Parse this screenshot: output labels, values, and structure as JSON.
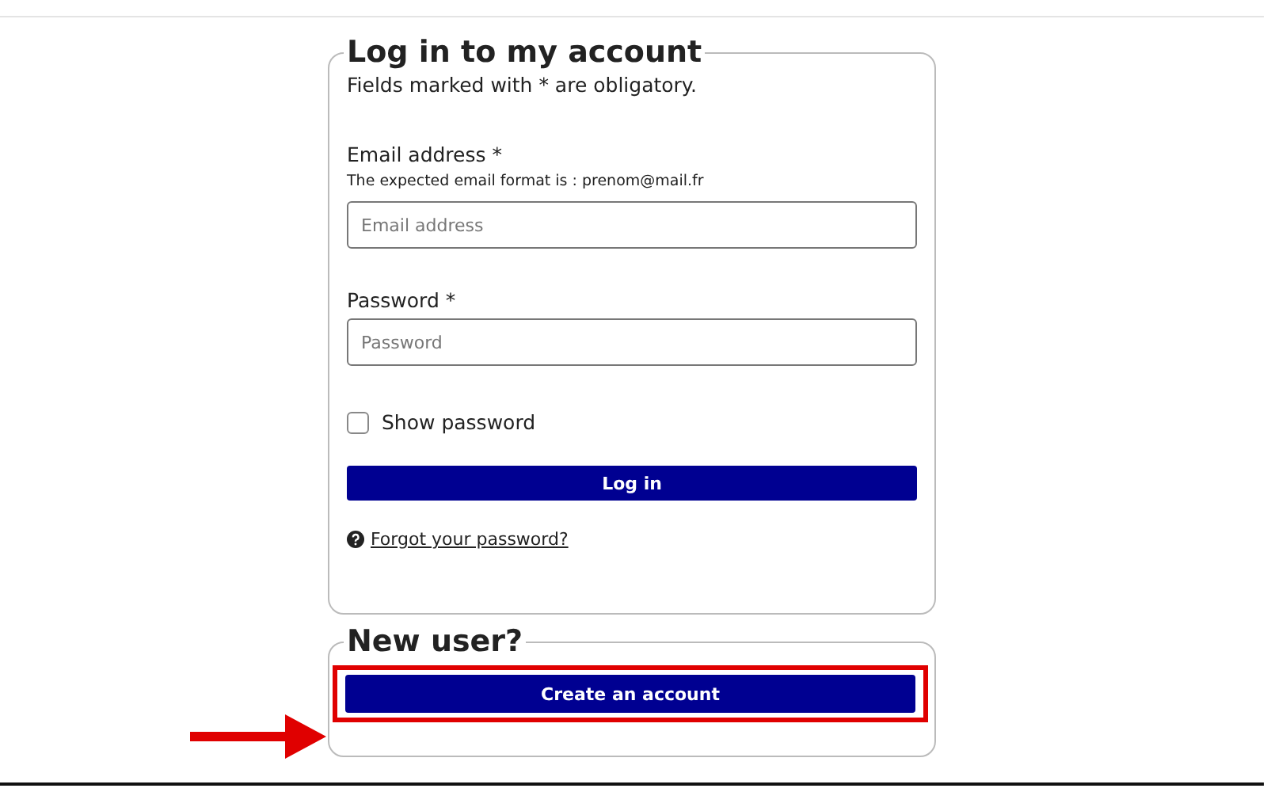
{
  "login": {
    "title": "Log in to my account",
    "note": "Fields marked with * are obligatory.",
    "fields": [
      {
        "label": "Email address *",
        "hint": "The expected email format is : prenom@mail.fr",
        "placeholder": "Email address"
      },
      {
        "label": "Password *",
        "placeholder": "Password"
      }
    ],
    "show_password": {
      "label": "Show password",
      "checked": false
    },
    "submit": "Log in",
    "forgot_link": "Forgot your password?"
  },
  "new_user": {
    "title": "New user?",
    "button": "Create an account",
    "highlighted": true
  }
}
